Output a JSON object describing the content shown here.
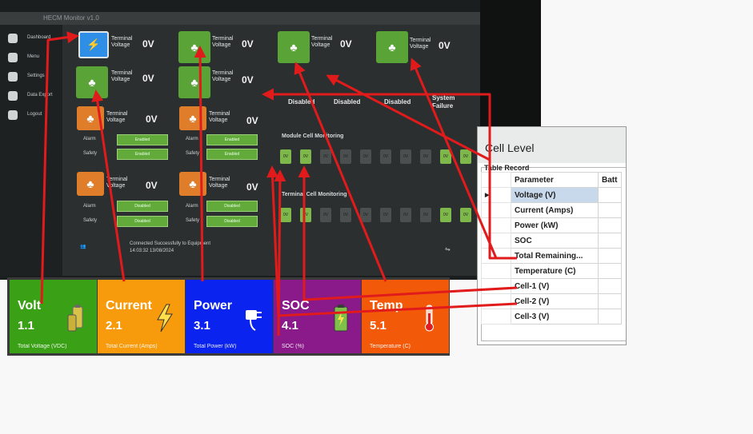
{
  "window_title": "HECM Monitor v1.0",
  "nav": [
    {
      "label": "Dashboard",
      "icon": "dashboard-icon"
    },
    {
      "label": "Menu",
      "icon": "menu-icon"
    },
    {
      "label": "Settings",
      "icon": "settings-icon"
    },
    {
      "label": "Data Export",
      "icon": "export-icon"
    },
    {
      "label": "Logout",
      "icon": "logout-icon"
    }
  ],
  "terminal": {
    "label": "Terminal Voltage",
    "value": "0V"
  },
  "status_texts": [
    "Disabled",
    "Disabled",
    "Disabled",
    "System Failure"
  ],
  "rows": {
    "alarm": "Alarm",
    "safety": "Safety",
    "btn_enabled": "Enabled",
    "btn_disabled": "Disabled"
  },
  "section_labels": {
    "module": "Module Cell Monitoring",
    "terminal": "Terminal Cell Monitoring"
  },
  "cell_value": "0V",
  "footer": {
    "connection": "Connected Successfully to Equipment",
    "time": "14:03:32  13/08/2024"
  },
  "cards": [
    {
      "name": "Volt",
      "value": "1.1",
      "sub": "Total Voltage (VDC)",
      "color": "#3aa015",
      "icon": "battery-icon"
    },
    {
      "name": "Current",
      "value": "2.1",
      "sub": "Total Current (Amps)",
      "color": "#f79a0c",
      "icon": "lightning-icon"
    },
    {
      "name": "Power",
      "value": "3.1",
      "sub": "Total Power (kW)",
      "color": "#0a23ee",
      "icon": "plug-icon"
    },
    {
      "name": "SOC",
      "value": "4.1",
      "sub": "SOC (%)",
      "color": "#8a1a8a",
      "icon": "battery-charge-icon"
    },
    {
      "name": "Temp",
      "value": "5.1",
      "sub": "Temperature (C)",
      "color": "#f25a0a",
      "icon": "thermometer-icon"
    }
  ],
  "cell_panel": {
    "title": "Cell Level",
    "group": "Table Record",
    "headers": [
      "Parameter",
      "Batt"
    ],
    "rows": [
      "Voltage (V)",
      "Current (Amps)",
      "Power (kW)",
      "SOC",
      "Total Remaining...",
      "Temperature (C)",
      "Cell-1 (V)",
      "Cell-2 (V)",
      "Cell-3 (V)"
    ]
  },
  "colors": {
    "arrow": "#e11b1b",
    "tile_green": "#5aa337",
    "tile_orange": "#e07d2b",
    "tile_blue": "#2f8ee6"
  }
}
